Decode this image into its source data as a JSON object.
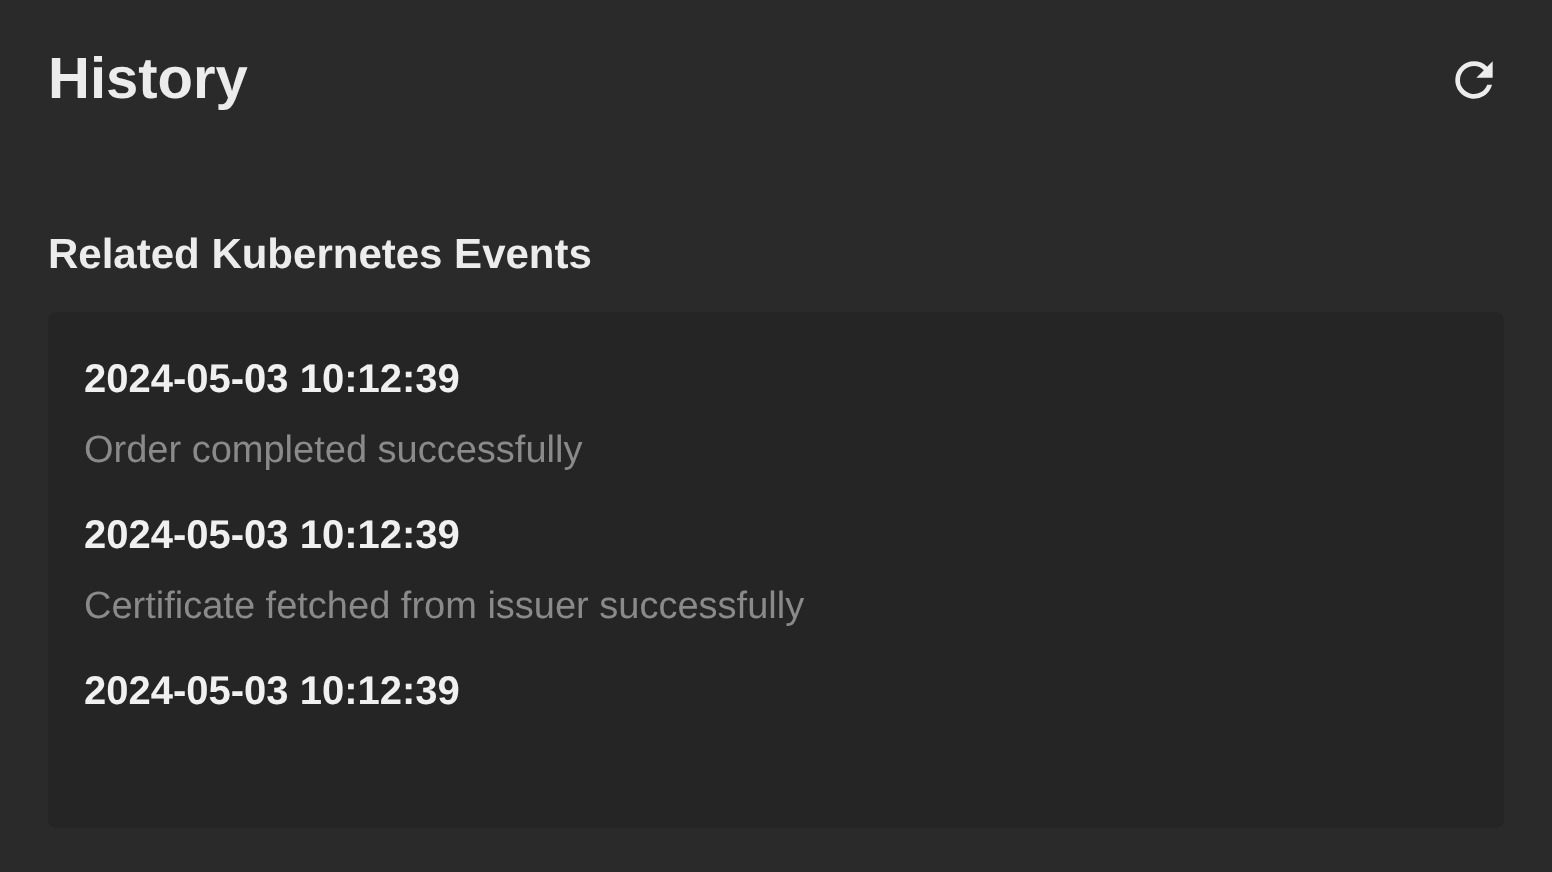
{
  "title": "History",
  "section_title": "Related Kubernetes Events",
  "events": [
    {
      "time": "2024-05-03 10:12:39",
      "message": "Order completed successfully"
    },
    {
      "time": "2024-05-03 10:12:39",
      "message": "Certificate fetched from issuer successfully"
    },
    {
      "time": "2024-05-03 10:12:39"
    }
  ]
}
